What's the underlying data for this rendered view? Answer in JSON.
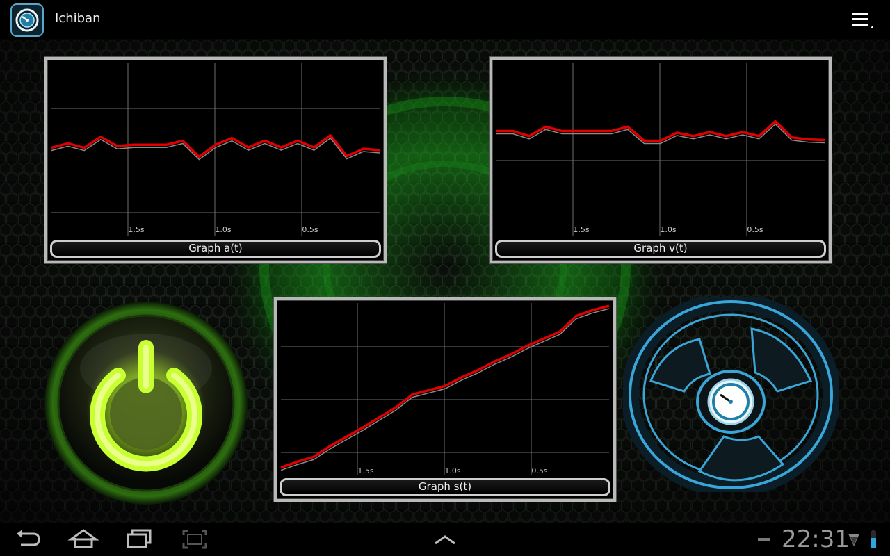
{
  "app": {
    "title": "Ichiban",
    "icon": "speedometer-app-icon",
    "overflow_icon": "overflow-menu-icon"
  },
  "colors": {
    "trace": "#e00000",
    "trace_shadow": "#8a8a8a",
    "grid": "#6e6e6e",
    "power_glow": "#c8ff30",
    "wheel": "#3aa6d8",
    "accent_green": "#1fbf1f"
  },
  "graphs": [
    {
      "id": "a",
      "label": "Graph a(t)",
      "tick_labels": [
        "1.5s",
        "1.0s",
        "0.5s"
      ],
      "chart_data": {
        "type": "line",
        "xlabel": "",
        "ylabel": "",
        "x": [
          20,
          19,
          18,
          17,
          16,
          15,
          14,
          13,
          12,
          11,
          10,
          9,
          8,
          7,
          6,
          5,
          4,
          3,
          2,
          1,
          0
        ],
        "series": [
          {
            "values": [
              0.05,
              0.18,
              0.05,
              0.38,
              0.1,
              0.14,
              0.14,
              0.14,
              0.26,
              -0.22,
              0.14,
              0.34,
              0.06,
              0.26,
              0.06,
              0.26,
              0.06,
              0.42,
              -0.2,
              0.02,
              -0.02
            ]
          }
        ],
        "ylim": [
          -2.6,
          2.6
        ]
      }
    },
    {
      "id": "v",
      "label": "Graph v(t)",
      "tick_labels": [
        "1.5s",
        "1.0s",
        "0.5s"
      ],
      "chart_data": {
        "type": "line",
        "xlabel": "",
        "ylabel": "",
        "x": [
          20,
          19,
          18,
          17,
          16,
          15,
          14,
          13,
          12,
          11,
          10,
          9,
          8,
          7,
          6,
          5,
          4,
          3,
          2,
          1,
          0
        ],
        "series": [
          {
            "values": [
              0.55,
              0.55,
              0.4,
              0.68,
              0.55,
              0.55,
              0.55,
              0.55,
              0.68,
              0.26,
              0.26,
              0.5,
              0.4,
              0.52,
              0.4,
              0.52,
              0.4,
              0.84,
              0.36,
              0.3,
              0.28
            ]
          }
        ],
        "ylim": [
          -2.6,
          2.6
        ]
      }
    },
    {
      "id": "s",
      "label": "Graph s(t)",
      "tick_labels": [
        "1.5s",
        "1.0s",
        "0.5s"
      ],
      "chart_data": {
        "type": "line",
        "xlabel": "",
        "ylabel": "",
        "x": [
          20,
          19,
          18,
          17,
          16,
          15,
          14,
          13,
          12,
          11,
          10,
          9,
          8,
          7,
          6,
          5,
          4,
          3,
          2,
          1,
          0
        ],
        "series": [
          {
            "values": [
              0.0,
              0.8,
              1.5,
              3.0,
              4.3,
              5.6,
              7.0,
              8.4,
              10.2,
              10.8,
              11.4,
              12.6,
              13.6,
              14.8,
              15.8,
              17.0,
              18.0,
              19.0,
              21.2,
              22.0,
              22.6
            ]
          }
        ],
        "ylim": [
          -1.0,
          23.0
        ]
      }
    }
  ],
  "nav": {
    "back_icon": "back-icon",
    "home_icon": "home-icon",
    "recent_icon": "recent-apps-icon",
    "screenshot_icon": "screenshot-icon",
    "up_icon": "chevron-up-icon",
    "minus_icon": "minimize-icon",
    "clock": "22:31",
    "wifi_icon": "wifi-icon",
    "battery_icon": "battery-icon"
  }
}
